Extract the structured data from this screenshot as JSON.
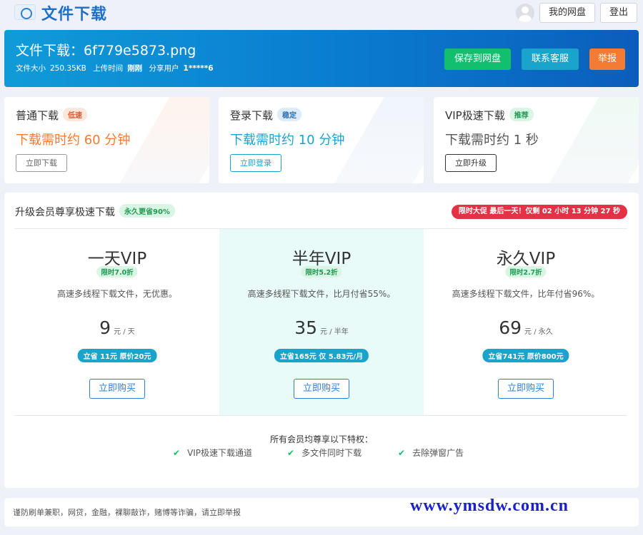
{
  "header": {
    "brand": "文件下载",
    "my_disk_label": "我的网盘",
    "logout_label": "登出"
  },
  "file": {
    "title": "文件下载：6f779e5873.png",
    "size_label": "文件大小",
    "size": "250.35KB",
    "upload_label": "上传时间",
    "upload_time": "刚刚",
    "share_label": "分享用户",
    "share_user": "1*****6"
  },
  "banner_actions": {
    "save": "保存到网盘",
    "support": "联系客服",
    "report": "举报"
  },
  "download_options": [
    {
      "title": "普通下载",
      "tag": "低速",
      "time": "下载需时约 60 分钟",
      "button": "立即下载",
      "color": "#f37b34"
    },
    {
      "title": "登录下载",
      "tag": "稳定",
      "time": "下载需时约 10 分钟",
      "button": "立即登录",
      "color": "#1aa4cc"
    },
    {
      "title": "VIP极速下载",
      "tag": "推荐",
      "time": "下载需时约 1 秒",
      "button": "立即升级",
      "color": "#333333"
    }
  ],
  "vip": {
    "heading": "升级会员尊享极速下载",
    "heading_tag": "永久更省90%",
    "promo": "限时大促 最后一天！仅剩 02 小时 13 分钟 27 秒",
    "plans": [
      {
        "name": "一天VIP",
        "discount": "限时7.0折",
        "desc": "高速多线程下载文件，无优惠。",
        "price": "9",
        "unit": "元 / 天",
        "save": "立省 11元 原价20元",
        "button": "立即购买"
      },
      {
        "name": "半年VIP",
        "discount": "限时5.2折",
        "desc": "高速多线程下载文件，比月付省55%。",
        "price": "35",
        "unit": "元 / 半年",
        "save": "立省165元 仅 5.83元/月",
        "button": "立即购买"
      },
      {
        "name": "永久VIP",
        "discount": "限时2.7折",
        "desc": "高速多线程下载文件，比年付省96%。",
        "price": "69",
        "unit": "元 / 永久",
        "save": "立省741元 原价800元",
        "button": "立即购买"
      }
    ],
    "perks_title": "所有会员均尊享以下特权：",
    "perks": [
      "VIP极速下载通道",
      "多文件同时下载",
      "去除弹窗广告"
    ]
  },
  "notice": "谨防刷单兼职，网贷，金融，裸聊敲诈，赌博等诈骗，请立即举报",
  "watermark": "www.ymsdw.com.cn",
  "colors": {
    "primary": "#0a7ed0",
    "green": "#12bf6e",
    "cyan": "#1aa4cc",
    "orange": "#f37b34",
    "red": "#e53145"
  }
}
